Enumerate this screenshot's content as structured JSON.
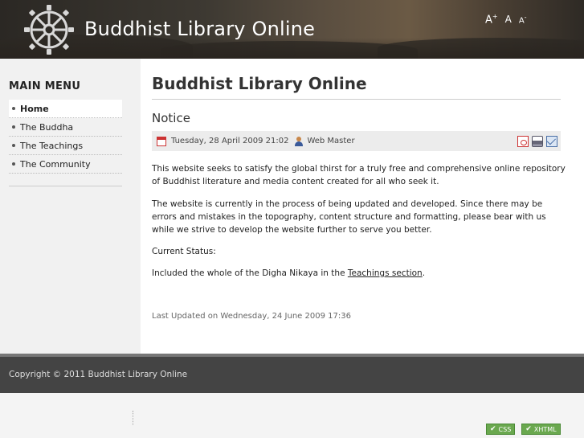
{
  "header": {
    "site_title": "Buddhist Library Online",
    "logo_icon": "dharma-wheel-icon",
    "font_controls": {
      "larger": "A",
      "normal": "A",
      "smaller": "A",
      "plus": "+",
      "minus": "-"
    }
  },
  "sidebar": {
    "title": "MAIN MENU",
    "items": [
      {
        "label": "Home",
        "active": true
      },
      {
        "label": "The Buddha",
        "active": false
      },
      {
        "label": "The Teachings",
        "active": false
      },
      {
        "label": "The Community",
        "active": false
      }
    ]
  },
  "main": {
    "page_title": "Buddhist Library Online",
    "article": {
      "title": "Notice",
      "date": "Tuesday, 28 April 2009 21:02",
      "author": "Web Master",
      "icons": [
        "pdf-icon",
        "print-icon",
        "email-icon"
      ],
      "paragraphs": {
        "p1": "This website seeks to satisfy the global thirst for a truly free and comprehensive online repository of Buddhist literature and media content created for all who seek it.",
        "p2": "The website is currently in the process of being updated and developed. Since there may be errors and mistakes in the topography, content structure and formatting, please bear with us while we strive to develop the website further to serve you better.",
        "p3": "Current Status:",
        "p4_prefix": "Included the whole of the Digha Nikaya in the ",
        "p4_link": "Teachings section",
        "p4_suffix": "."
      },
      "last_updated": "Last Updated on Wednesday, 24 June 2009 17:36"
    }
  },
  "footer": {
    "copyright": "Copyright © 2011 Buddhist Library Online",
    "badges": {
      "css": "CSS",
      "xhtml": "XHTML",
      "check": "✔"
    }
  },
  "colors": {
    "header_bg": "#3d3932",
    "footer_bg": "#444444",
    "badge_green": "#6aa84f"
  }
}
